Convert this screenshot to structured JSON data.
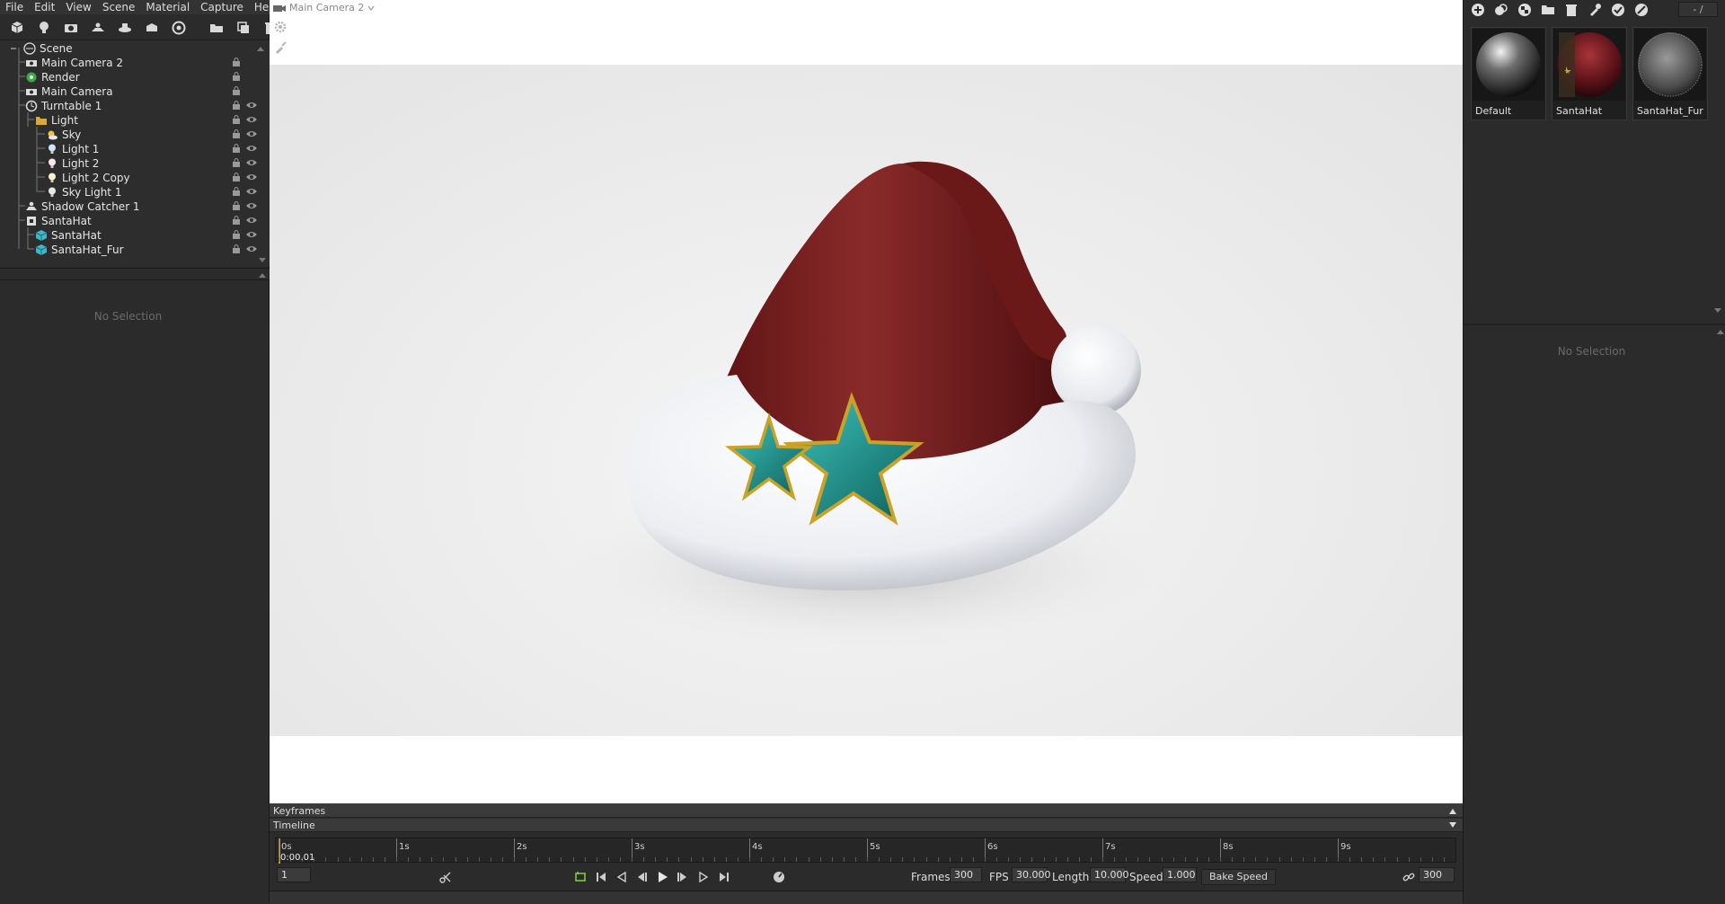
{
  "menu": [
    "File",
    "Edit",
    "View",
    "Scene",
    "Material",
    "Capture",
    "Help"
  ],
  "left_toolbar_icons": [
    "add-object-icon",
    "light-bulb-icon",
    "camera-icon",
    "shadow-catcher-icon",
    "turntable-icon",
    "group-icon",
    "render-icon",
    "folder-icon",
    "duplicate-icon",
    "trash-icon"
  ],
  "scene_tree": [
    {
      "label": "Scene",
      "icon": "scene-icon",
      "depth": 0
    },
    {
      "label": "Main Camera 2",
      "icon": "camera-icon",
      "depth": 1
    },
    {
      "label": "Render",
      "icon": "render-icon",
      "depth": 1
    },
    {
      "label": "Main Camera",
      "icon": "camera-icon",
      "depth": 1
    },
    {
      "label": "Turntable 1",
      "icon": "turntable-icon",
      "depth": 1
    },
    {
      "label": "Light",
      "icon": "folder-icon",
      "depth": 2
    },
    {
      "label": "Sky",
      "icon": "sky-icon",
      "depth": 3
    },
    {
      "label": "Light 1",
      "icon": "light-bulb-icon",
      "depth": 3
    },
    {
      "label": "Light 2",
      "icon": "light-bulb-icon",
      "depth": 3
    },
    {
      "label": "Light 2 Copy",
      "icon": "light-bulb-icon",
      "depth": 3
    },
    {
      "label": "Sky Light 1",
      "icon": "light-bulb-icon",
      "depth": 3
    },
    {
      "label": "Shadow Catcher 1",
      "icon": "shadow-catcher-icon",
      "depth": 1
    },
    {
      "label": "SantaHat",
      "icon": "mesh-icon",
      "depth": 1
    },
    {
      "label": "SantaHat",
      "icon": "cube-icon",
      "depth": 2
    },
    {
      "label": "SantaHat_Fur",
      "icon": "cube-icon",
      "depth": 2
    }
  ],
  "left_no_selection": "No Selection",
  "viewport": {
    "camera_label": "Main Camera 2"
  },
  "timeline": {
    "keyframes_label": "Keyframes",
    "timeline_label": "Timeline",
    "ticks": [
      "0s",
      "1s",
      "2s",
      "3s",
      "4s",
      "5s",
      "6s",
      "7s",
      "8s",
      "9s"
    ],
    "current_time": "0:00.01",
    "frame_field": "1",
    "frames_label": "Frames",
    "frames_value": "300",
    "fps_label": "FPS",
    "fps_value": "30.000",
    "length_label": "Length",
    "length_value": "10.000",
    "speed_label": "Speed",
    "speed_value": "1.000",
    "bake_speed_label": "Bake Speed",
    "end_frame_value": "300"
  },
  "right_toolbar_icons": [
    "add-material-icon",
    "clone-material-icon",
    "checker-icon",
    "folder-icon",
    "trash-icon",
    "pick-material-icon",
    "apply-material-icon",
    "clear-material-icon"
  ],
  "material_filter": "- /",
  "materials": [
    {
      "name": "Default",
      "thumb": "default-sphere"
    },
    {
      "name": "SantaHat",
      "thumb": "santahat-thumb"
    },
    {
      "name": "SantaHat_Fur",
      "thumb": "fur-sphere"
    }
  ],
  "right_no_selection": "No Selection",
  "colors": {
    "panel_bg": "#2b2b2b",
    "hat_red": "#7a1f1f",
    "fur_white": "#f2f2f4",
    "star_teal": "#1e8f8a",
    "star_gold": "#c9a227"
  }
}
